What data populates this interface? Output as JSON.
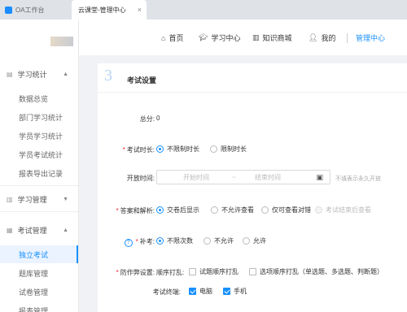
{
  "browser": {
    "tabs": [
      {
        "label": "OA工作台"
      },
      {
        "label": "云课堂-管理中心",
        "close": "×"
      }
    ]
  },
  "header": {
    "nav": [
      {
        "icon": "home-icon",
        "label": "首页"
      },
      {
        "icon": "graduation-cap-icon",
        "label": "学习中心"
      },
      {
        "icon": "books-icon",
        "label": "知识商城"
      },
      {
        "icon": "user-icon",
        "label": "我的"
      },
      {
        "label": "管理中心",
        "active": true
      }
    ]
  },
  "sidebar": {
    "groups": [
      {
        "label": "学习统计",
        "items": [
          "数据总览",
          "部门学习统计",
          "学员学习统计",
          "学员考试统计",
          "报表导出记录"
        ]
      },
      {
        "label": "学习管理"
      },
      {
        "label": "考试管理",
        "items": [
          "独立考试",
          "题库管理",
          "试卷管理",
          "报表管理"
        ]
      }
    ]
  },
  "section": {
    "number": "3",
    "title": "考试设置"
  },
  "form": {
    "total_label": "总分:",
    "total_value": "0",
    "duration_label": "考试时长:",
    "duration_options": [
      "不限制时长",
      "限制时长"
    ],
    "open_label": "开放时间:",
    "open_start_placeholder": "开始时间",
    "open_separator": "~",
    "open_end_placeholder": "结束时间",
    "open_hint": "不填表示永久开放",
    "answer_label": "答案和解析:",
    "answer_options": [
      "交卷后显示",
      "不允许查看",
      "仅可查看对错",
      "考试结束后查看"
    ],
    "makeup_label": "补考:",
    "makeup_options": [
      "不限次数",
      "不允许",
      "允许"
    ],
    "cheat_label": "防作弊设置:",
    "order_label": "顺序打乱:",
    "order_options": [
      "试题顺序打乱",
      "选项顺序打乱（单选题、多选题、判断题）"
    ],
    "terminal_label": "考试终端:",
    "terminal_options": [
      "电脑",
      "手机"
    ]
  },
  "colors": {
    "accent": "#1890ff",
    "required": "#f5222d"
  }
}
